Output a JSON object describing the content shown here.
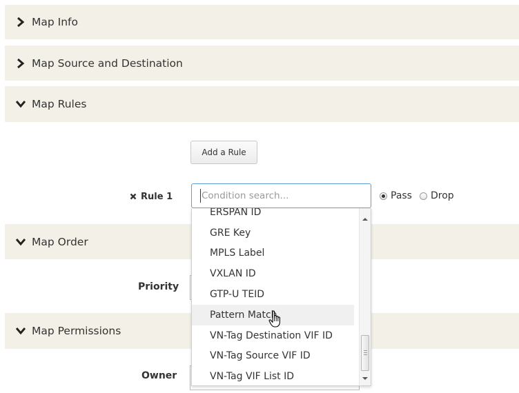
{
  "sections": {
    "map_info": "Map Info",
    "map_source_destination": "Map Source and Destination",
    "map_rules": "Map Rules",
    "map_order": "Map Order",
    "map_permissions": "Map Permissions"
  },
  "rules": {
    "add_rule_label": "Add a Rule",
    "rule_label": "Rule 1",
    "remove_icon": "close-icon",
    "search_placeholder": "Condition search...",
    "pass_label": "Pass",
    "drop_label": "Drop",
    "selected_action": "Pass"
  },
  "order": {
    "priority_label": "Priority"
  },
  "permissions": {
    "owner_label": "Owner"
  },
  "dropdown": {
    "items": [
      "ERSPAN ID",
      "GRE Key",
      "MPLS Label",
      "VXLAN ID",
      "GTP-U TEID",
      "Pattern Match",
      "VN-Tag Destination VIF ID",
      "VN-Tag Source VIF ID",
      "VN-Tag VIF List ID"
    ],
    "hovered": "Pattern Match"
  },
  "colors": {
    "section_bg": "#f3f1e7",
    "focus_border": "#5aa0d8"
  }
}
